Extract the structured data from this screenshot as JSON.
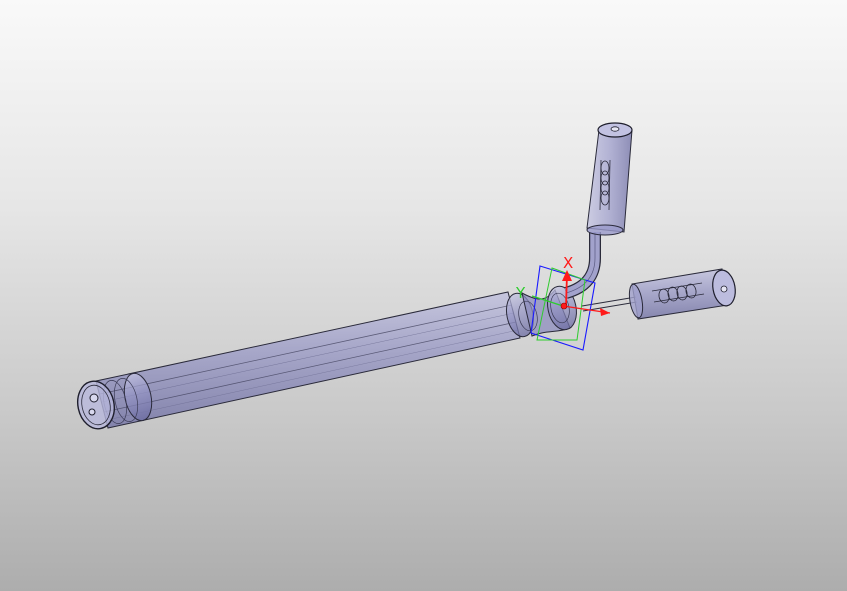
{
  "viewport": {
    "background_top": "#f9f9f9",
    "background_bottom": "#adadad"
  },
  "model": {
    "body_fill": "#9a9ac8",
    "outline": "#2a2a3a"
  },
  "triad": {
    "x_label": "X",
    "y_label": "Y",
    "x_color": "#ff1a1a",
    "y_color": "#2ecc2e",
    "z_color": "#1a1aff"
  }
}
